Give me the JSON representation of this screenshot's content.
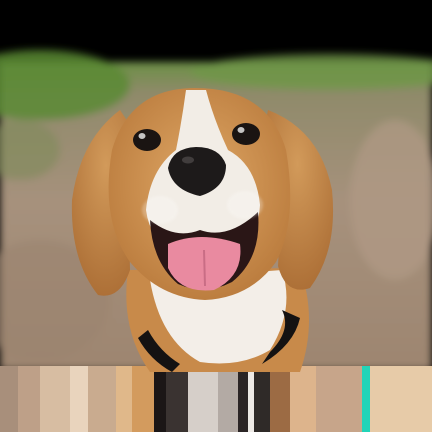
{
  "image": {
    "subject": "dog-photo",
    "colors": {
      "bar": "#000000",
      "grass": "#5e8a3a",
      "ground": "#a88e78",
      "fur_tan": "#c98a45",
      "fur_white": "#f2ede6",
      "nose": "#1c1a1a",
      "tongue": "#e98aa0",
      "collar": "#111111"
    }
  }
}
